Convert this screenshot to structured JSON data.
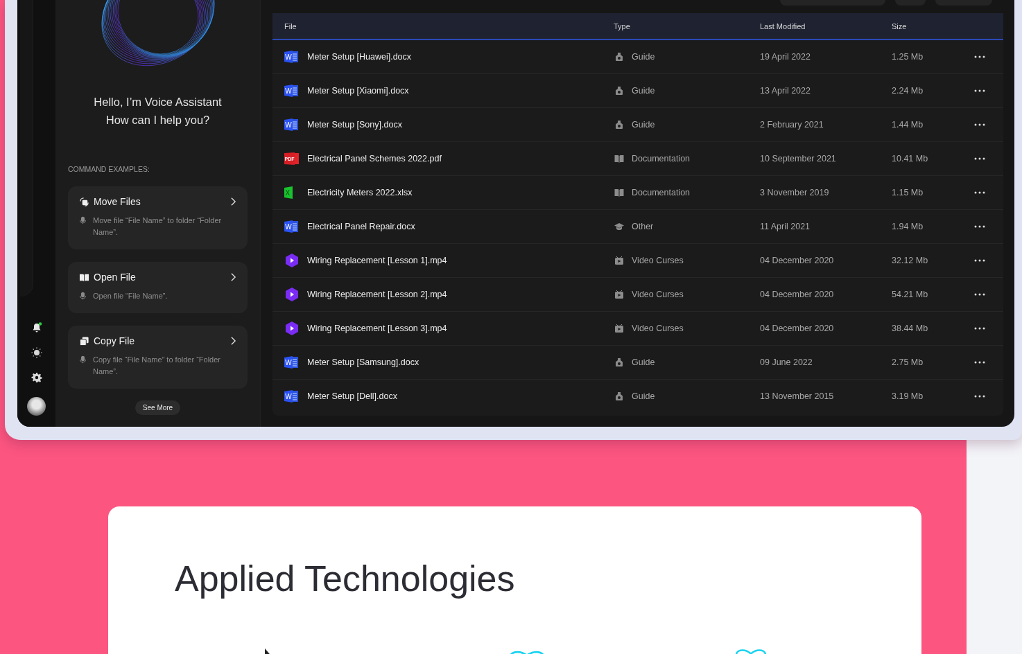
{
  "nav": {
    "has_notifications": true
  },
  "assistant": {
    "greeting": [
      "Hello, I’m Voice Assistant",
      "How can I help you?"
    ],
    "examples_label": "COMMAND EXAMPLES:",
    "commands": [
      {
        "kind": "move",
        "title": "Move Files",
        "example": "Move file “File Name” to folder “Folder Name”."
      },
      {
        "kind": "open",
        "title": "Open File",
        "example": "Open file “File Name”."
      },
      {
        "kind": "copy",
        "title": "Copy File",
        "example": "Copy file “File Name” to folder “Folder Name”."
      }
    ],
    "see_more": "See More"
  },
  "table": {
    "columns": [
      "File",
      "Type",
      "Last Modified",
      "Size"
    ],
    "rows": [
      {
        "file": {
          "kind": "word",
          "badge": "W",
          "name": "Meter Setup [Huawei].docx"
        },
        "type": {
          "kind": "guide",
          "label": "Guide"
        },
        "modified": "19 April 2022",
        "size": "1.25 Mb"
      },
      {
        "file": {
          "kind": "word",
          "badge": "W",
          "name": "Meter Setup [Xiaomi].docx"
        },
        "type": {
          "kind": "guide",
          "label": "Guide"
        },
        "modified": "13 April 2022",
        "size": "2.24 Mb"
      },
      {
        "file": {
          "kind": "word",
          "badge": "W",
          "name": "Meter Setup [Sony].docx"
        },
        "type": {
          "kind": "guide",
          "label": "Guide"
        },
        "modified": "2 February 2021",
        "size": "1.44 Mb"
      },
      {
        "file": {
          "kind": "pdf",
          "badge": "PDF",
          "name": "Electrical Panel Schemes 2022.pdf"
        },
        "type": {
          "kind": "documentation",
          "label": "Documentation"
        },
        "modified": "10 September 2021",
        "size": "10.41 Mb"
      },
      {
        "file": {
          "kind": "excel",
          "badge": "X",
          "name": "Electricity Meters 2022.xlsx"
        },
        "type": {
          "kind": "documentation",
          "label": "Documentation"
        },
        "modified": "3 November 2019",
        "size": "1.15 Mb"
      },
      {
        "file": {
          "kind": "word",
          "badge": "W",
          "name": "Electrical Panel Repair.docx"
        },
        "type": {
          "kind": "other",
          "label": "Other"
        },
        "modified": "11 April 2021",
        "size": "1.94 Mb"
      },
      {
        "file": {
          "kind": "video",
          "name": "Wiring Replacement [Lesson 1].mp4"
        },
        "type": {
          "kind": "video",
          "label": "Video Curses"
        },
        "modified": "04 December 2020",
        "size": "32.12 Mb"
      },
      {
        "file": {
          "kind": "video",
          "name": "Wiring Replacement [Lesson 2].mp4"
        },
        "type": {
          "kind": "video",
          "label": "Video Curses"
        },
        "modified": "04 December 2020",
        "size": "54.21 Mb"
      },
      {
        "file": {
          "kind": "video",
          "name": "Wiring Replacement [Lesson 3].mp4"
        },
        "type": {
          "kind": "video",
          "label": "Video Curses"
        },
        "modified": "04 December 2020",
        "size": "38.44 Mb"
      },
      {
        "file": {
          "kind": "word",
          "badge": "W",
          "name": "Meter Setup [Samsung].docx"
        },
        "type": {
          "kind": "guide",
          "label": "Guide"
        },
        "modified": "09 June 2022",
        "size": "2.75 Mb"
      },
      {
        "file": {
          "kind": "word",
          "badge": "W",
          "name": "Meter Setup [Dell].docx"
        },
        "type": {
          "kind": "guide",
          "label": "Guide"
        },
        "modified": "13 November 2015",
        "size": "3.19 Mb"
      }
    ]
  },
  "section": {
    "title": "Applied Technologies"
  }
}
